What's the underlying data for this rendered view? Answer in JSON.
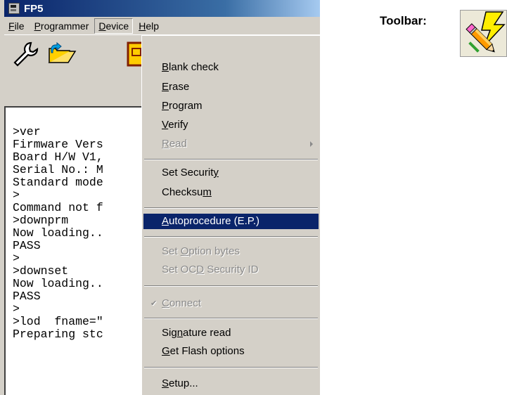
{
  "window": {
    "title": "FP5"
  },
  "menubar": {
    "file": {
      "pre": "",
      "u": "F",
      "post": "ile"
    },
    "programmer": {
      "pre": "",
      "u": "P",
      "post": "rogrammer"
    },
    "device": {
      "pre": "",
      "u": "D",
      "post": "evice"
    },
    "help": {
      "pre": "",
      "u": "H",
      "post": "elp"
    }
  },
  "toolbar_icons": [
    "wrench-icon",
    "open-folder-icon",
    "device-icon"
  ],
  "console": {
    "lines": [
      ">ver",
      "Firmware Vers",
      "Board H/W V1,",
      "Serial No.: M",
      "Standard mode",
      ">",
      "Command not f",
      ">downprm",
      "Now loading..",
      "PASS",
      ">",
      ">downset",
      "Now loading..",
      "PASS",
      ">",
      ">lod  fname=\"",
      "Preparing stc"
    ]
  },
  "device_menu": {
    "blank_check": {
      "pre": "",
      "u": "B",
      "post": "lank check"
    },
    "erase": {
      "pre": "",
      "u": "E",
      "post": "rase"
    },
    "program": {
      "pre": "",
      "u": "P",
      "post": "rogram"
    },
    "verify": {
      "pre": "",
      "u": "V",
      "post": "erify"
    },
    "read": {
      "pre": "",
      "u": "R",
      "post": "ead"
    },
    "set_security": {
      "pre": "Set Securit",
      "u": "y",
      "post": ""
    },
    "checksum": {
      "pre": "Checksu",
      "u": "m",
      "post": ""
    },
    "autoprocedure": {
      "pre": "",
      "u": "A",
      "post": "utoprocedure (E.P.)"
    },
    "set_option_bytes": {
      "pre": "Set ",
      "u": "O",
      "post": "ption bytes"
    },
    "set_ocd_security": {
      "pre": "Set OC",
      "u": "D",
      "post": " Security ID"
    },
    "connect": {
      "pre": "",
      "u": "C",
      "post": "onnect"
    },
    "signature_read": {
      "pre": "Sig",
      "u": "n",
      "post": "ature read"
    },
    "get_flash_options": {
      "pre": "",
      "u": "G",
      "post": "et Flash options"
    },
    "setup": {
      "pre": "",
      "u": "S",
      "post": "etup..."
    }
  },
  "annotation": {
    "caption": "Toolbar:",
    "icon": "autoprocedure-toolbar-icon"
  },
  "colors": {
    "titlebar_start": "#0a246a",
    "highlight": "#0a246a",
    "face": "#d4d0c8"
  }
}
